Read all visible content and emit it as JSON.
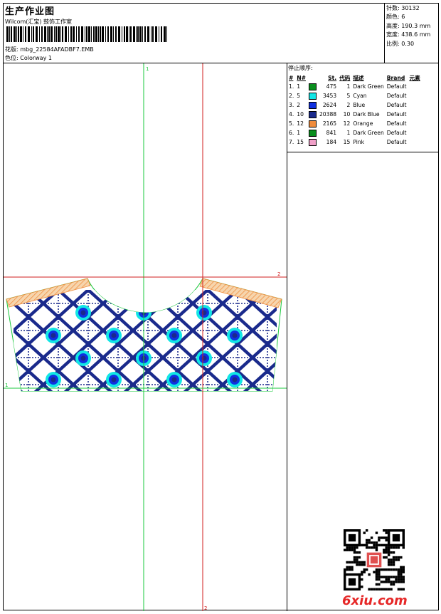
{
  "header": {
    "title": "生产作业图",
    "studio": "Wilcom(汇宝) 鼓饰工作室",
    "design_label": "花版:",
    "design_file": "mbg_22584AFADBF7.EMB",
    "colorway_label": "色位:",
    "colorway": "Colorway 1"
  },
  "stats": [
    {
      "label": "针数",
      "value": "30132"
    },
    {
      "label": "颜色",
      "value": "6"
    },
    {
      "label": "高度",
      "value": "190.3 mm"
    },
    {
      "label": "宽度",
      "value": "438.6 mm"
    },
    {
      "label": "比例",
      "value": "0.30"
    }
  ],
  "stop_sequence": {
    "title": "停止顺序:",
    "columns": [
      "#",
      "N#",
      "St.",
      "代码",
      "描述",
      "Brand",
      "元素"
    ],
    "rows": [
      {
        "idx": "1.",
        "n": "1",
        "st": "475",
        "code": "1",
        "desc": "Dark Green",
        "brand": "Default",
        "color": "#0a8f1e"
      },
      {
        "idx": "2.",
        "n": "5",
        "st": "3453",
        "code": "5",
        "desc": "Cyan",
        "brand": "Default",
        "color": "#12e6e6"
      },
      {
        "idx": "3.",
        "n": "2",
        "st": "2624",
        "code": "2",
        "desc": "Blue",
        "brand": "Default",
        "color": "#1030e0"
      },
      {
        "idx": "4.",
        "n": "10",
        "st": "20388",
        "code": "10",
        "desc": "Dark Blue",
        "brand": "Default",
        "color": "#1a2a8c"
      },
      {
        "idx": "5.",
        "n": "12",
        "st": "2165",
        "code": "12",
        "desc": "Orange",
        "brand": "Default",
        "color": "#f08c3c"
      },
      {
        "idx": "6.",
        "n": "1",
        "st": "841",
        "code": "1",
        "desc": "Dark Green",
        "brand": "Default",
        "color": "#0a8f1e"
      },
      {
        "idx": "7.",
        "n": "15",
        "st": "184",
        "code": "15",
        "desc": "Pink",
        "brand": "Default",
        "color": "#f0a0c8"
      }
    ]
  },
  "guides": {
    "top_mark": "1",
    "left_mark": "1",
    "right_mark": "2",
    "bottom_mark": "2"
  },
  "watermark": "6xiu.com",
  "colors": {
    "guide_green": "#19c83c",
    "guide_red": "#d21e1e",
    "thread_dark_blue": "#1a2a8c",
    "thread_blue": "#1030e0",
    "thread_cyan": "#12e6e6",
    "thread_orange": "#f08c3c"
  }
}
